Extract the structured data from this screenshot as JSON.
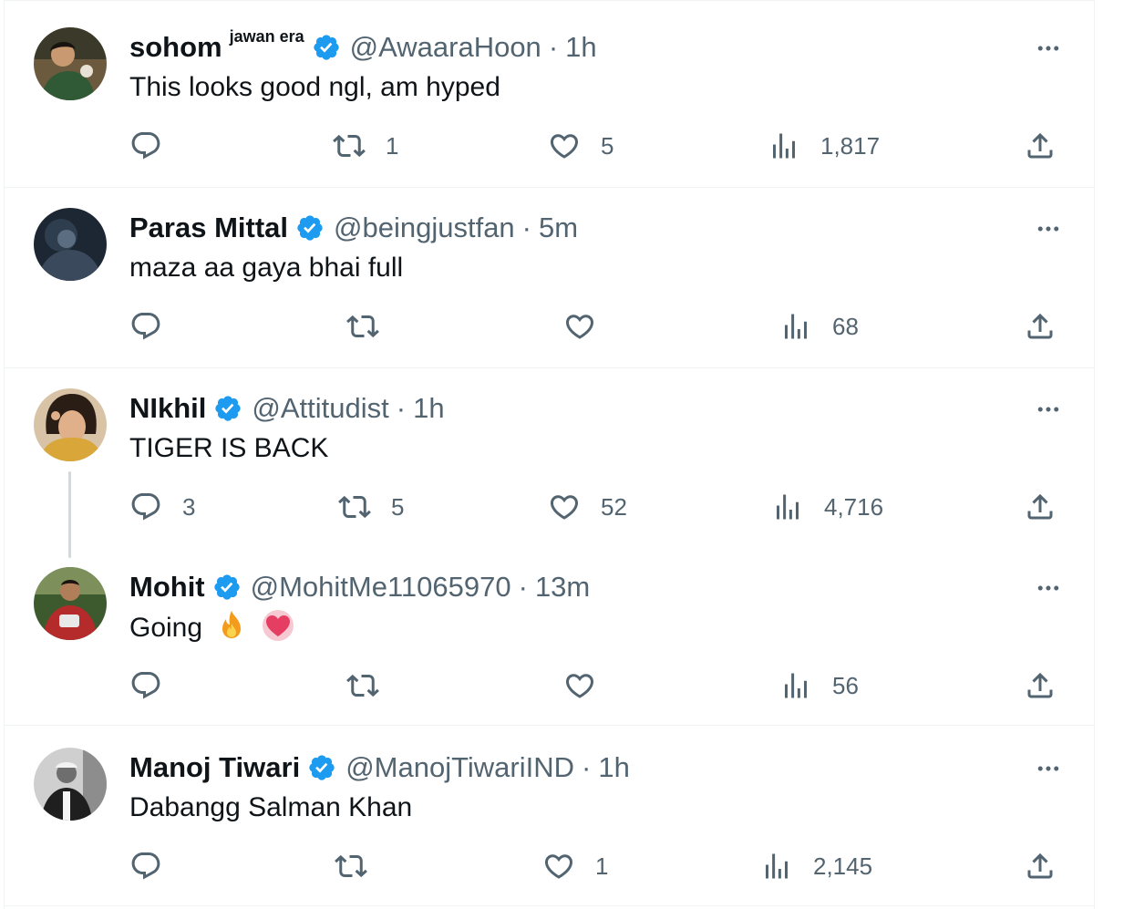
{
  "colors": {
    "verified": "#1d9bf0",
    "meta_text": "#536471",
    "primary_text": "#0f1419",
    "divider": "#eff3f4",
    "heart_emoji": "#e63e62",
    "fire_emoji": "#f29b1d"
  },
  "icons": {
    "reply": "reply-icon",
    "repost": "repost-icon",
    "like": "heart-icon",
    "views": "views-chart-icon",
    "share": "share-icon",
    "more": "more-icon",
    "verified": "verified-badge-icon"
  },
  "tweets": [
    {
      "name": "sohom",
      "superscript": "jawan era",
      "handle": "@AwaaraHoon",
      "sep": "·",
      "time": "1h",
      "text": "This looks good ngl, am hyped",
      "replies": "",
      "reposts": "1",
      "likes": "5",
      "views": "1,817"
    },
    {
      "name": "Paras Mittal",
      "handle": "@beingjustfan",
      "sep": "·",
      "time": "5m",
      "text": "maza aa gaya bhai full",
      "replies": "",
      "reposts": "",
      "likes": "",
      "views": "68"
    },
    {
      "name": "NIkhil",
      "handle": "@Attitudist",
      "sep": "·",
      "time": "1h",
      "text": "TIGER IS BACK",
      "replies": "3",
      "reposts": "5",
      "likes": "52",
      "views": "4,716"
    },
    {
      "name": "Mohit",
      "handle": "@MohitMe11065970",
      "sep": "·",
      "time": "13m",
      "text": "Going",
      "replies": "",
      "reposts": "",
      "likes": "",
      "views": "56",
      "emojis": [
        "fire",
        "heart"
      ]
    },
    {
      "name": "Manoj Tiwari",
      "handle": "@ManojTiwariIND",
      "sep": "·",
      "time": "1h",
      "text": "Dabangg Salman Khan",
      "replies": "",
      "reposts": "",
      "likes": "1",
      "views": "2,145"
    }
  ]
}
